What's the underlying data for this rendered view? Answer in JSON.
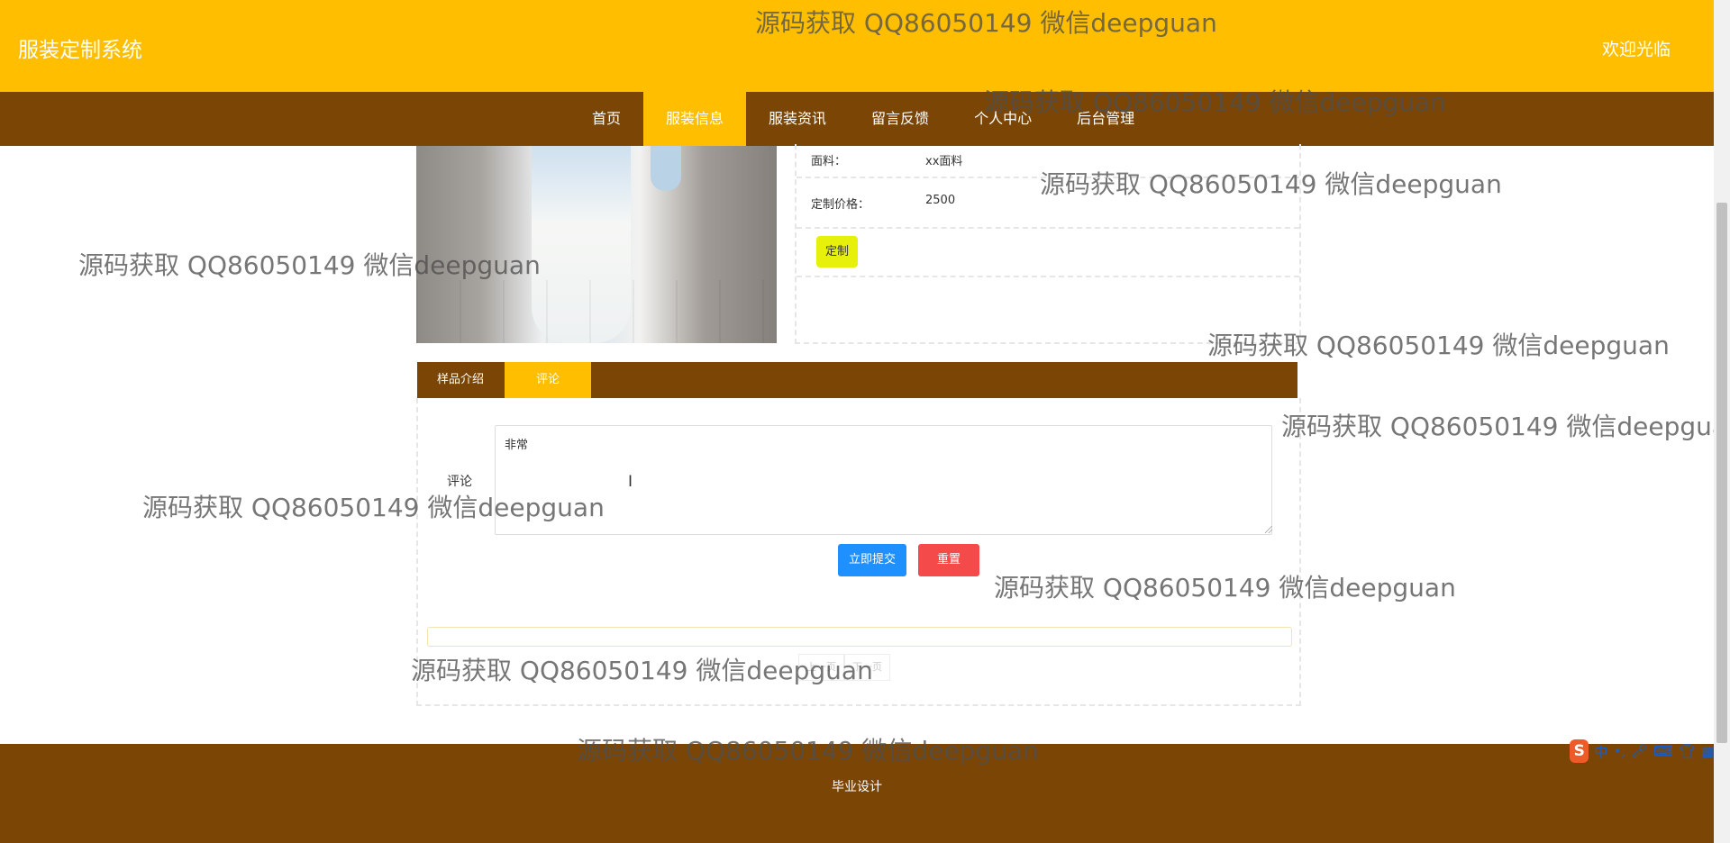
{
  "header": {
    "brand": "服装定制系统",
    "welcome": "欢迎光临"
  },
  "nav": {
    "items": [
      {
        "label": "首页"
      },
      {
        "label": "服装信息",
        "active": true
      },
      {
        "label": "服装资讯"
      },
      {
        "label": "留言反馈"
      },
      {
        "label": "个人中心"
      },
      {
        "label": "后台管理"
      }
    ]
  },
  "product": {
    "fabric_label": "面料：",
    "fabric_value": "xx面料",
    "price_label": "定制价格：",
    "price_value": "2500",
    "custom_button": "定制"
  },
  "tabs": [
    {
      "label": "样品介绍"
    },
    {
      "label": "评论",
      "active": true
    }
  ],
  "comment_form": {
    "label": "评论",
    "value": "非常",
    "submit": "立即提交",
    "reset": "重置"
  },
  "pager": {
    "prev": "上一页",
    "next": "下一页"
  },
  "footer": {
    "text": "毕业设计"
  },
  "watermark": "源码获取 QQ86050149 微信deepguan",
  "ime": {
    "logo": "S",
    "mode": "中"
  },
  "colors": {
    "header_bg": "#FFBE00",
    "nav_bg": "#7A4505",
    "submit_btn": "#1E90FF",
    "reset_btn": "#F44A4A",
    "custom_btn": "#E6F00B"
  }
}
